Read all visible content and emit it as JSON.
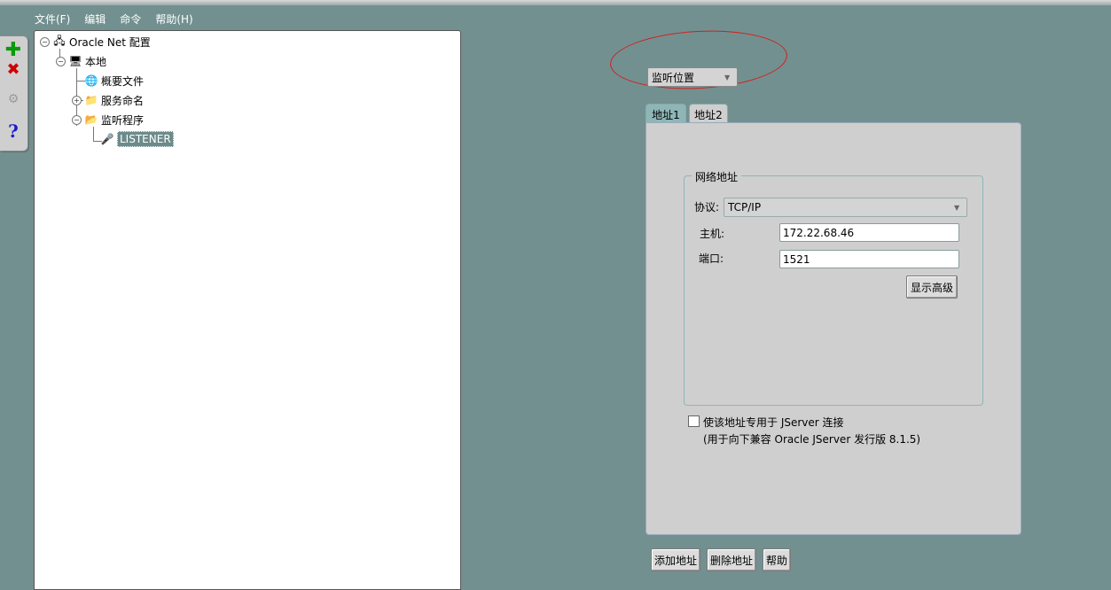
{
  "menu": {
    "file": "文件(F)",
    "edit": "编辑",
    "command": "命令",
    "help": "帮助(H)"
  },
  "toolbar": {
    "add_icon": "plus-icon",
    "delete_icon": "x-icon",
    "test_icon": "test-icon",
    "help_icon": "question-icon"
  },
  "tree": {
    "root": "Oracle Net 配置",
    "local": "本地",
    "profile": "概要文件",
    "naming": "服务命名",
    "listeners": "监听程序",
    "listener": "LISTENER"
  },
  "location_combo": "监听位置",
  "tabs": [
    "地址1",
    "地址2"
  ],
  "network": {
    "title": "网络地址",
    "protocol_label": "协议:",
    "protocol_value": "TCP/IP",
    "host_label": "主机:",
    "host_value": "172.22.68.46",
    "port_label": "端口:",
    "port_value": "1521",
    "advanced_button": "显示高级"
  },
  "jserver": {
    "checkbox_label": "使该地址专用于 JServer 连接",
    "note": "(用于向下兼容 Oracle JServer 发行版 8.1.5)"
  },
  "buttons": {
    "add_address": "添加地址",
    "delete_address": "删除地址",
    "help": "帮助"
  },
  "colors": {
    "background": "#739090",
    "panel": "#cfcfcf",
    "annotation": "#d02020",
    "selected": "#6c8b8b"
  }
}
